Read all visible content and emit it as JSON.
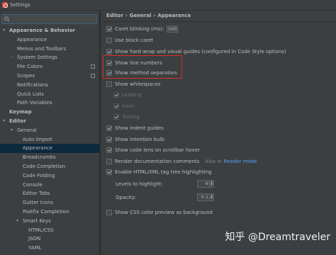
{
  "window": {
    "title": "Settings"
  },
  "search": {
    "placeholder": "",
    "value": ""
  },
  "tree": [
    {
      "label": "Appearance & Behavior",
      "level": 0,
      "arrow": "▾",
      "bold": true
    },
    {
      "label": "Appearance",
      "level": 1
    },
    {
      "label": "Menus and Toolbars",
      "level": 1
    },
    {
      "label": "System Settings",
      "level": 1,
      "arrow": "›"
    },
    {
      "label": "File Colors",
      "level": 1,
      "project": true
    },
    {
      "label": "Scopes",
      "level": 1,
      "project": true
    },
    {
      "label": "Notifications",
      "level": 1
    },
    {
      "label": "Quick Lists",
      "level": 1
    },
    {
      "label": "Path Variables",
      "level": 1
    },
    {
      "label": "Keymap",
      "level": 0,
      "bold": true
    },
    {
      "label": "Editor",
      "level": 0,
      "arrow": "▾",
      "bold": true
    },
    {
      "label": "General",
      "level": 1,
      "arrow": "▾"
    },
    {
      "label": "Auto Import",
      "level": 2
    },
    {
      "label": "Appearance",
      "level": 2,
      "selected": true
    },
    {
      "label": "Breadcrumbs",
      "level": 2
    },
    {
      "label": "Code Completion",
      "level": 2
    },
    {
      "label": "Code Folding",
      "level": 2
    },
    {
      "label": "Console",
      "level": 2
    },
    {
      "label": "Editor Tabs",
      "level": 2
    },
    {
      "label": "Gutter Icons",
      "level": 2
    },
    {
      "label": "Postfix Completion",
      "level": 2
    },
    {
      "label": "Smart Keys",
      "level": 2,
      "arrow": "▾"
    },
    {
      "label": "HTML/CSS",
      "level": 3
    },
    {
      "label": "JSON",
      "level": 3
    },
    {
      "label": "YAML",
      "level": 3
    }
  ],
  "breadcrumb": [
    "Editor",
    "›",
    "General",
    "›",
    "Appearance"
  ],
  "options": {
    "caret_blinking": {
      "label": "Caret blinking (ms):",
      "value": "500",
      "checked": true
    },
    "block_caret": {
      "label": "Use block caret",
      "checked": false
    },
    "hard_wrap": {
      "label": "Show hard wrap and visual guides (configured in Code Style options)",
      "checked": true
    },
    "line_numbers": {
      "label": "Show line numbers",
      "checked": true
    },
    "method_separators": {
      "label": "Show method separators",
      "checked": true
    },
    "whitespaces": {
      "label": "Show whitespaces",
      "checked": false
    },
    "leading": {
      "label": "Leading",
      "checked": true
    },
    "inner": {
      "label": "Inner",
      "checked": true
    },
    "trailing": {
      "label": "Trailing",
      "checked": true
    },
    "indent_guides": {
      "label": "Show indent guides",
      "checked": true
    },
    "intention_bulb": {
      "label": "Show intention bulb",
      "checked": true
    },
    "code_lens": {
      "label": "Show code lens on scrollbar hover",
      "checked": true
    },
    "render_docs": {
      "label": "Render documentation comments",
      "checked": false,
      "also_in": "Also in",
      "link": "Reader mode"
    },
    "html_tag_tree": {
      "label": "Enable HTML/XML tag tree highlighting",
      "checked": true
    },
    "levels": {
      "label": "Levels to highlight:",
      "value": "6"
    },
    "opacity": {
      "label": "Opacity:",
      "value": "0.1"
    },
    "css_color": {
      "label": "Show CSS color preview as background",
      "checked": false
    }
  },
  "watermark": "知乎 @Dreamtraveler",
  "colors": {
    "highlight": "#e02a2a",
    "selection": "#0d293e",
    "link": "#589df6"
  }
}
